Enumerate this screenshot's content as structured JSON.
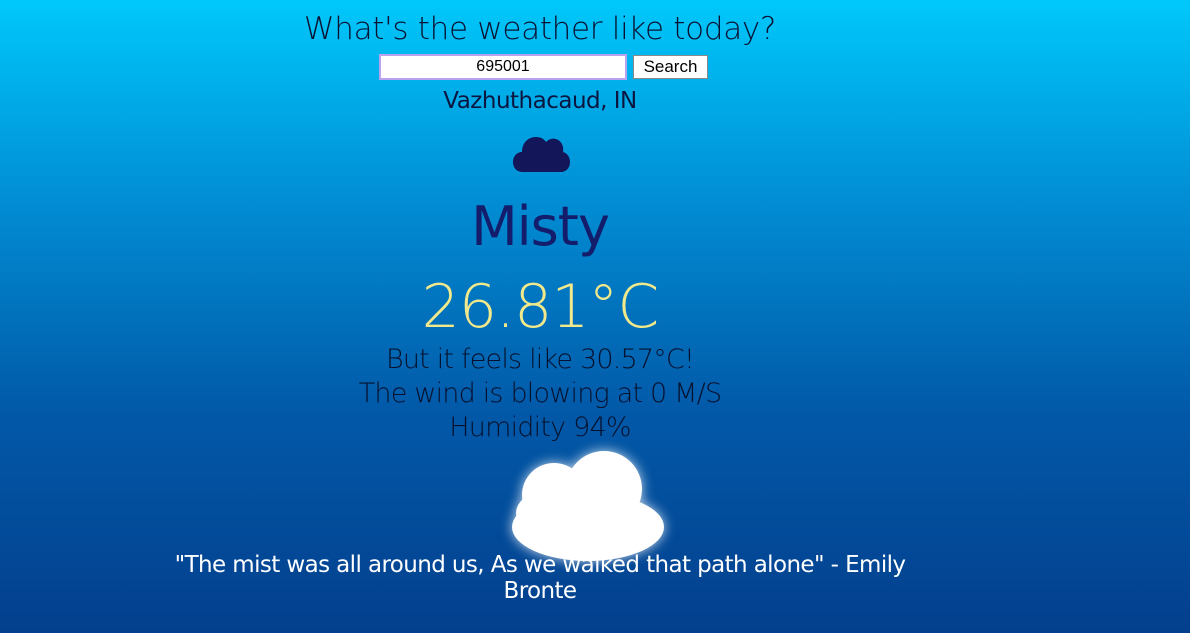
{
  "header": {
    "question": "What's the weather like today?"
  },
  "search": {
    "value": "695001",
    "button_label": "Search"
  },
  "weather": {
    "location": "Vazhuthacaud, IN",
    "condition": "Misty",
    "temperature": "26.81°C",
    "feels_like": "But it feels like 30.57°C!",
    "wind": "The wind is blowing at 0 M/S",
    "humidity": "Humidity 94%",
    "icon": "cloud-icon"
  },
  "quote": {
    "text": "\"The mist was all around us, As we walked that path alone\" - Emily Bronte"
  },
  "colors": {
    "background_top": "#00c8fb",
    "background_bottom": "#033f8d",
    "condition": "#141d6b",
    "temperature": "#f1e98b",
    "small_cloud": "#131658",
    "big_cloud": "#ffffff"
  }
}
